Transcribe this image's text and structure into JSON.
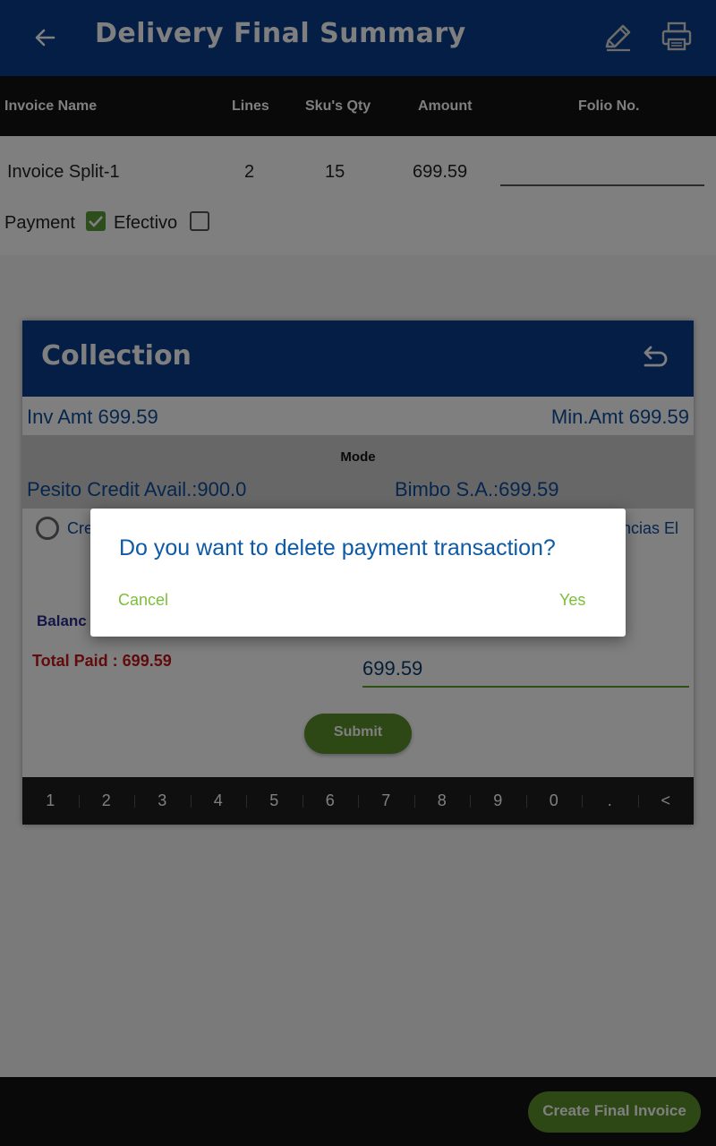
{
  "appbar": {
    "title": "Delivery Final Summary"
  },
  "table": {
    "headers": [
      "Invoice Name",
      "Lines",
      "Sku's Qty",
      "Amount",
      "Folio No."
    ],
    "row": {
      "invoice_name": "Invoice Split-1",
      "lines": "2",
      "qty": "15",
      "amount": "699.59",
      "folio": ""
    }
  },
  "payment": {
    "label": "Payment",
    "efectivo_label": "Efectivo",
    "payment_checked": true,
    "efectivo_checked": false
  },
  "collection": {
    "title": "Collection",
    "inv_amt": "Inv Amt  699.59",
    "min_amt": "Min.Amt  699.59",
    "mode_label": "Mode",
    "credit_avail": "Pesito Credit Avail.:900.0",
    "bimbo": "Bimbo S.A.:699.59",
    "radio_left_label": "Cre",
    "radio_right_label": "encias El",
    "balance_label": "Balanc",
    "total_paid": "Total Paid : 699.59",
    "amount_value": "699.59",
    "submit_label": "Submit",
    "keypad": [
      "1",
      "2",
      "3",
      "4",
      "5",
      "6",
      "7",
      "8",
      "9",
      "0",
      ".",
      "<"
    ]
  },
  "footer": {
    "create_final_invoice": "Create Final Invoice"
  },
  "dialog": {
    "message": "Do you want to delete payment transaction?",
    "cancel": "Cancel",
    "yes": "Yes"
  },
  "colors": {
    "primary": "#0a3d8a",
    "accent_green": "#5a8f2a",
    "dialog_text": "#0d5aa6",
    "dialog_buttons": "#7cbf3a",
    "total_paid": "#c01818"
  }
}
